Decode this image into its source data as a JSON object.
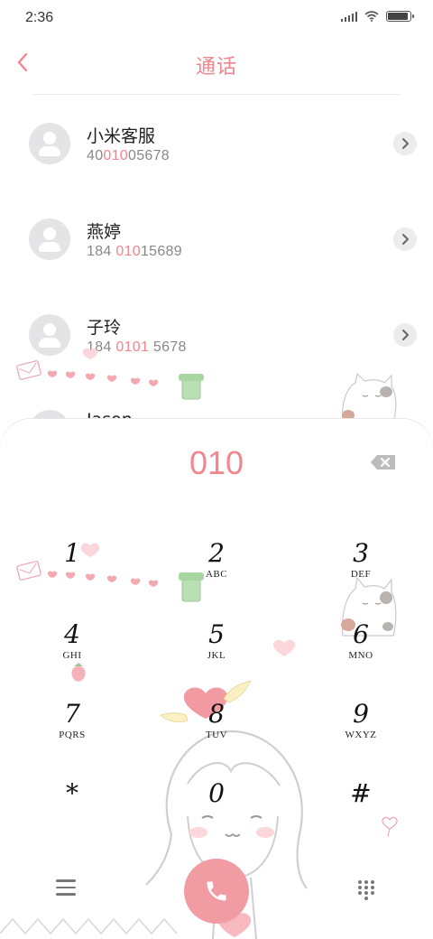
{
  "status_bar": {
    "time": "2:36"
  },
  "header": {
    "title": "通话"
  },
  "contacts": [
    {
      "name": "小米客服",
      "number_before": "40",
      "number_match": "010",
      "number_after": "05678"
    },
    {
      "name": "燕婷",
      "number_before": "184 ",
      "number_match": "010",
      "number_after": "15689"
    },
    {
      "name": "子玲",
      "number_before": "184 ",
      "number_match": "0101",
      "number_after": " 5678"
    },
    {
      "name": "Jason",
      "number_before": "",
      "number_match": "",
      "number_after": ""
    }
  ],
  "dialer": {
    "input_value": "010",
    "keys": [
      {
        "digit": "1",
        "letters": ""
      },
      {
        "digit": "2",
        "letters": "ABC"
      },
      {
        "digit": "3",
        "letters": "DEF"
      },
      {
        "digit": "4",
        "letters": "GHI"
      },
      {
        "digit": "5",
        "letters": "JKL"
      },
      {
        "digit": "6",
        "letters": "MNO"
      },
      {
        "digit": "7",
        "letters": "PQRS"
      },
      {
        "digit": "8",
        "letters": "TUV"
      },
      {
        "digit": "9",
        "letters": "WXYZ"
      },
      {
        "digit": "*",
        "letters": ""
      },
      {
        "digit": "0",
        "letters": ""
      },
      {
        "digit": "#",
        "letters": ""
      }
    ]
  },
  "icons": {
    "back": "chevron-left-icon",
    "backspace": "backspace-icon",
    "menu": "menu-icon",
    "call": "phone-icon",
    "dialpad": "dialpad-icon",
    "detail": "chevron-right-icon"
  },
  "colors": {
    "accent": "#f2858d",
    "call_button": "#f19ca3"
  }
}
